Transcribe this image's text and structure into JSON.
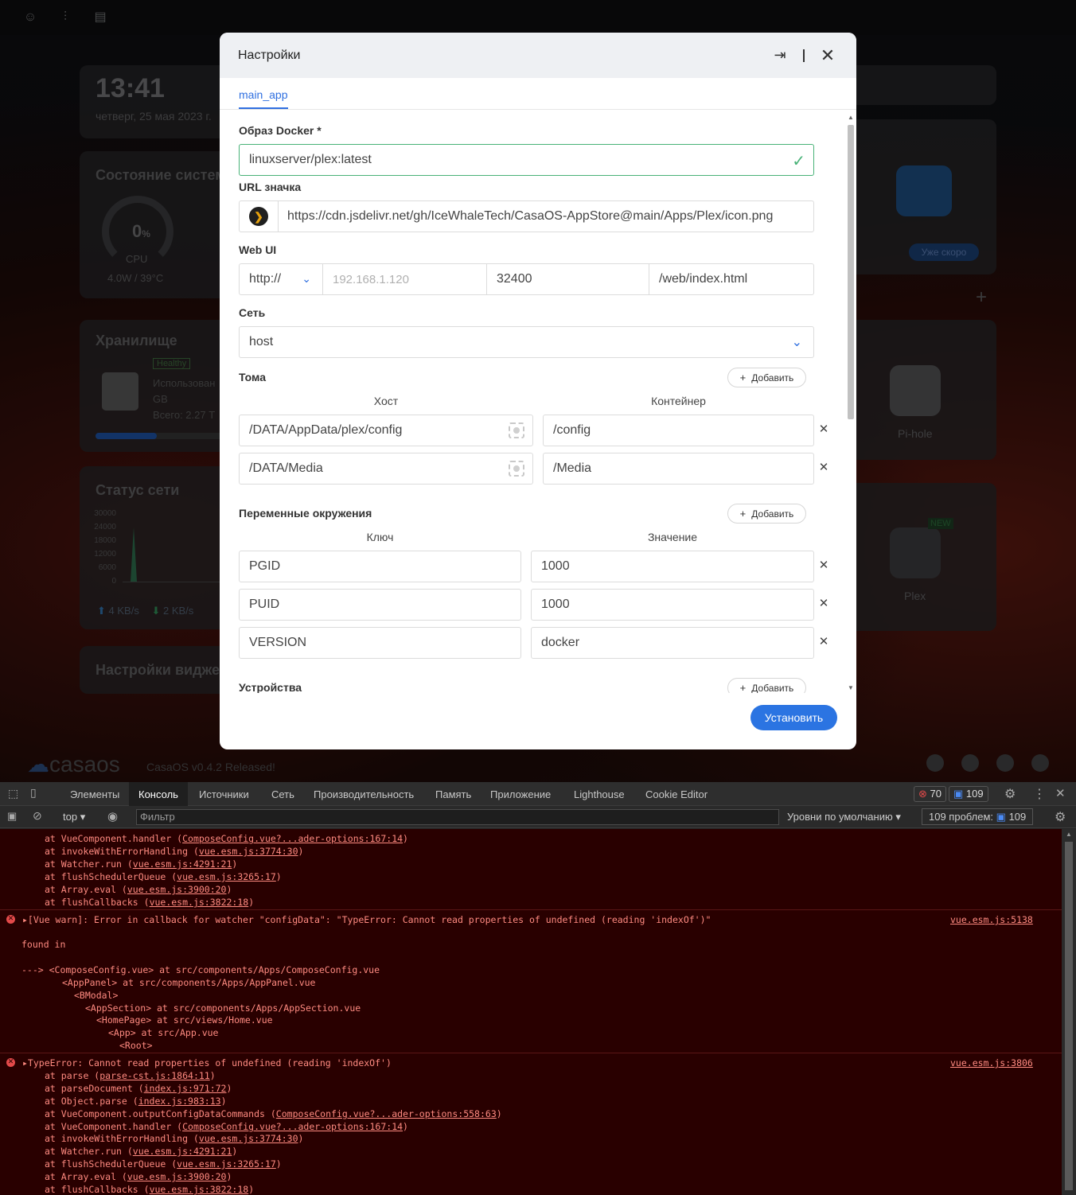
{
  "background": {
    "time": "13:41",
    "date": "четверг, 25 мая 2023 г.",
    "system_status_title": "Состояние систем",
    "cpu_percent": "0",
    "cpu_unit": "%",
    "cpu_label": "CPU",
    "cpu_power": "4.0W / 39°C",
    "storage_title": "Хранилище",
    "storage_badge": "Healthy",
    "storage_used": "Использован",
    "storage_gb": "GB",
    "storage_total": "Всего: 2.27 T",
    "storage_fill": 0.45,
    "network_title": "Статус сети",
    "network_ticks": [
      "30000",
      "24000",
      "18000",
      "12000",
      "6000",
      "0"
    ],
    "net_up": "4 KB/s",
    "net_down": "2 KB/s",
    "widget_settings": "Настройки виджет",
    "soon_label": "Уже скоро",
    "pihole_label": "Pi-hole",
    "plex_label": "Plex",
    "new_badge": "NEW",
    "casaos_logo": "casaos",
    "release_text": "CasaOS v0.4.2 Released!"
  },
  "modal": {
    "title": "Настройки",
    "tab": "main_app",
    "docker_image_label": "Образ Docker *",
    "docker_image_value": "linuxserver/plex:latest",
    "icon_url_label": "URL значка",
    "icon_url_value": "https://cdn.jsdelivr.net/gh/IceWhaleTech/CasaOS-AppStore@main/Apps/Plex/icon.png",
    "webui_label": "Web UI",
    "webui_scheme": "http://",
    "webui_host_placeholder": "192.168.1.120",
    "webui_port": "32400",
    "webui_path": "/web/index.html",
    "network_label": "Сеть",
    "network_value": "host",
    "volumes_label": "Тома",
    "add_label": "Добавить",
    "host_col": "Хост",
    "container_col": "Контейнер",
    "volumes": [
      {
        "host": "/DATA/AppData/plex/config",
        "container": "/config"
      },
      {
        "host": "/DATA/Media",
        "container": "/Media"
      }
    ],
    "env_label": "Переменные окружения",
    "key_col": "Ключ",
    "value_col": "Значение",
    "env": [
      {
        "key": "PGID",
        "value": "1000"
      },
      {
        "key": "PUID",
        "value": "1000"
      },
      {
        "key": "VERSION",
        "value": "docker"
      }
    ],
    "devices_label": "Устройства",
    "install_button": "Установить"
  },
  "devtools": {
    "tabs": [
      "Элементы",
      "Консоль",
      "Источники",
      "Сеть",
      "Производительность",
      "Память",
      "Приложение",
      "Lighthouse",
      "Cookie Editor"
    ],
    "errors_count": "70",
    "messages_count": "109",
    "context": "top",
    "filter_placeholder": "Фильтр",
    "levels": "Уровни по умолчанию",
    "issues_label": "109 проблем:",
    "issues_count": "109"
  }
}
